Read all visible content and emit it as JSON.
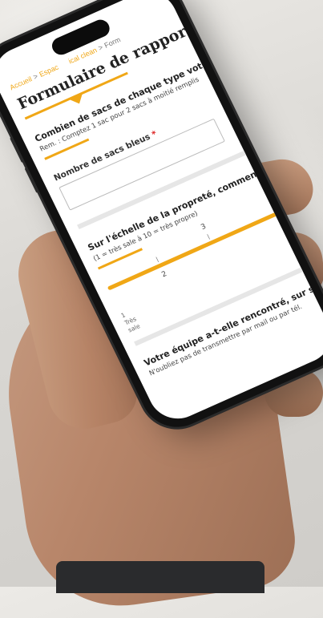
{
  "breadcrumb": {
    "home": "Accueil",
    "separator": ">",
    "espace": "Espac",
    "section": "ical clean",
    "current": "Form"
  },
  "form": {
    "title": "Formulaire de rapportag",
    "question_bags": "Combien de sacs de chaque type votre é",
    "hint_bags": "Rem. : Comptez 1 sac pour 2 sacs à moitié remplis",
    "label_blue_bags": "Nombre de sacs bleus",
    "required_marker": "*",
    "question_clean": "Sur l'échelle de la propreté, comment év",
    "hint_clean": "(1 = très sale à 10 = très propre)",
    "scale_numbers": [
      "1",
      "2",
      "3"
    ],
    "scale_low_label_line1": "Très",
    "scale_low_label_line2": "sale",
    "scale_value_1": "1",
    "question_team": "Votre équipe a-t-elle rencontré, sur son",
    "hint_team": "N'oubliez pas de transmettre par mail ou par tél."
  },
  "colors": {
    "accent": "#f0a716",
    "text": "#222222",
    "required": "#dd2222"
  }
}
